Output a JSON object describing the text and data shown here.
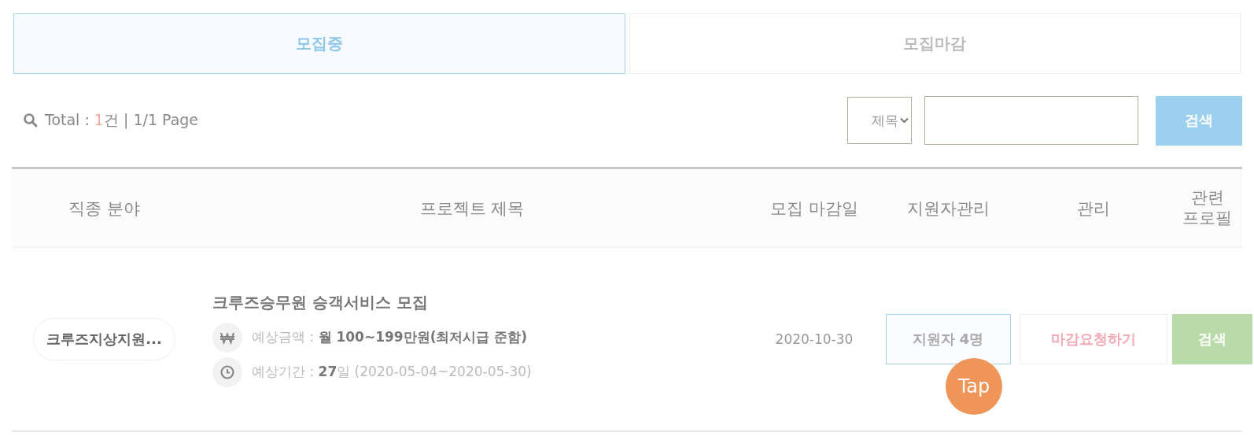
{
  "tabs": [
    {
      "label": "모집중",
      "selected": true
    },
    {
      "label": "모집마감",
      "selected": false
    }
  ],
  "summary": [
    {
      "kind": "plain",
      "text": "Total : "
    },
    {
      "kind": "highlight",
      "text": "1"
    },
    {
      "kind": "plain",
      "text": "건 | 1/1 Page"
    }
  ],
  "search": {
    "select": "제목",
    "button": "검색"
  },
  "table": {
    "columns": [
      "직종 분야",
      "프로젝트 제목",
      "모집 마감일",
      "지원자관리",
      "관리",
      "관련 프로필"
    ],
    "rows": [
      {
        "category": "크루즈지상지원...",
        "title": "크루즈승무원 승객서비스 모집",
        "details": [
          {
            "kind": "money",
            "text": "예상금액 : **월 100~199만원(최저시급 준함)**"
          },
          {
            "kind": "period",
            "text": "예상기간 : **27**일 (2020-05-04~2020-05-30)"
          }
        ],
        "deadline": "2020-10-30",
        "applicants_button": "지원자 4명",
        "close_button": "마감요청하기",
        "profile_button": "검색"
      }
    ]
  },
  "tap_hint": "Tap"
}
